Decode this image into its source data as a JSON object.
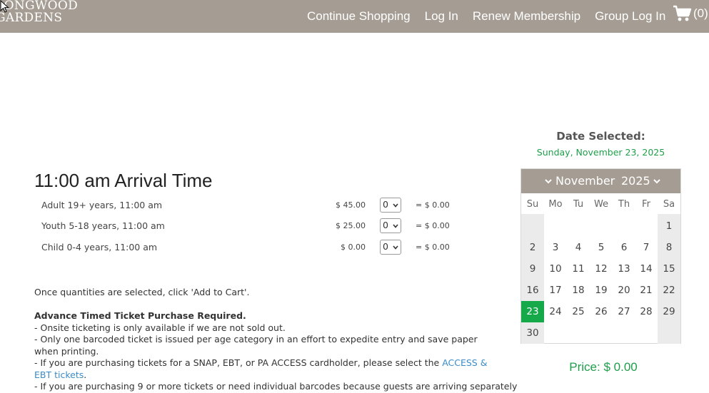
{
  "header": {
    "logo_line1": "LONGWOOD",
    "logo_line2": "GARDENS",
    "nav": [
      "Continue Shopping",
      "Log In",
      "Renew Membership",
      "Group Log In"
    ],
    "cart_count": "(0)"
  },
  "session": {
    "title": "11:00 am Arrival Time",
    "tickets": [
      {
        "label": "Adult 19+ years, 11:00 am",
        "price": "$ 45.00",
        "qty": "0",
        "total": "= $ 0.00"
      },
      {
        "label": "Youth 5-18 years, 11:00 am",
        "price": "$ 25.00",
        "qty": "0",
        "total": "= $ 0.00"
      },
      {
        "label": "Child 0-4 years, 11:00 am",
        "price": "$ 0.00",
        "qty": "0",
        "total": "= $ 0.00"
      }
    ]
  },
  "info": {
    "instruction": "Once quantities are selected, click 'Add to Cart'.",
    "heading": "Advance Timed Ticket Purchase Required.",
    "line1": "- Onsite ticketing is only available if we are not sold out.",
    "line2": "- Only one barcoded ticket is issued per age category in an effort to expedite entry and save paper when printing.",
    "line3_pre": "- If you are purchasing tickets for a SNAP, EBT, or PA ACCESS cardholder, please select the ",
    "line3_link": "ACCESS & EBT tickets",
    "line3_post": ".",
    "line4": "- If you are purchasing 9 or more tickets or need individual barcodes because guests are arriving separately"
  },
  "date_panel": {
    "label": "Date Selected:",
    "value": "Sunday, November 23, 2025"
  },
  "calendar": {
    "month": "November",
    "year": "2025",
    "weekdays": [
      "Su",
      "Mo",
      "Tu",
      "We",
      "Th",
      "Fr",
      "Sa"
    ],
    "weeks": [
      [
        "",
        "",
        "",
        "",
        "",
        "",
        "1"
      ],
      [
        "2",
        "3",
        "4",
        "5",
        "6",
        "7",
        "8"
      ],
      [
        "9",
        "10",
        "11",
        "12",
        "13",
        "14",
        "15"
      ],
      [
        "16",
        "17",
        "18",
        "19",
        "20",
        "21",
        "22"
      ],
      [
        "23",
        "24",
        "25",
        "26",
        "27",
        "28",
        "29"
      ],
      [
        "30",
        "",
        "",
        "",
        "",
        "",
        ""
      ]
    ],
    "selected_day": "23",
    "accent": "#16a94a",
    "header_color": "#a59d93"
  },
  "price": {
    "label": "Price:",
    "value": "$ 0.00"
  }
}
